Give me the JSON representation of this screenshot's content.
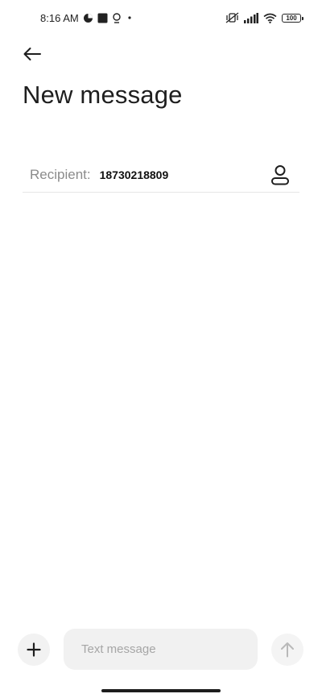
{
  "status_bar": {
    "time": "8:16 AM",
    "battery": "100",
    "left_icons": [
      "app-notification-icon",
      "square-notification-icon",
      "location-icon",
      "dot-icon"
    ],
    "right_icons": [
      "vibrate-off-icon",
      "signal-icon",
      "wifi-icon",
      "battery-icon"
    ]
  },
  "header": {
    "back_icon": "back-arrow-icon",
    "title": "New message"
  },
  "recipient": {
    "label": "Recipient:",
    "value": "18730218809",
    "contact_icon": "contact-icon"
  },
  "composer": {
    "attach_icon": "plus-icon",
    "placeholder": "Text message",
    "value": "",
    "send_icon": "send-arrow-icon"
  },
  "colors": {
    "title": "#1e1e1e",
    "label": "#8b8b8b",
    "input_bg": "#f1f1f1",
    "placeholder": "#a6a6a6"
  }
}
